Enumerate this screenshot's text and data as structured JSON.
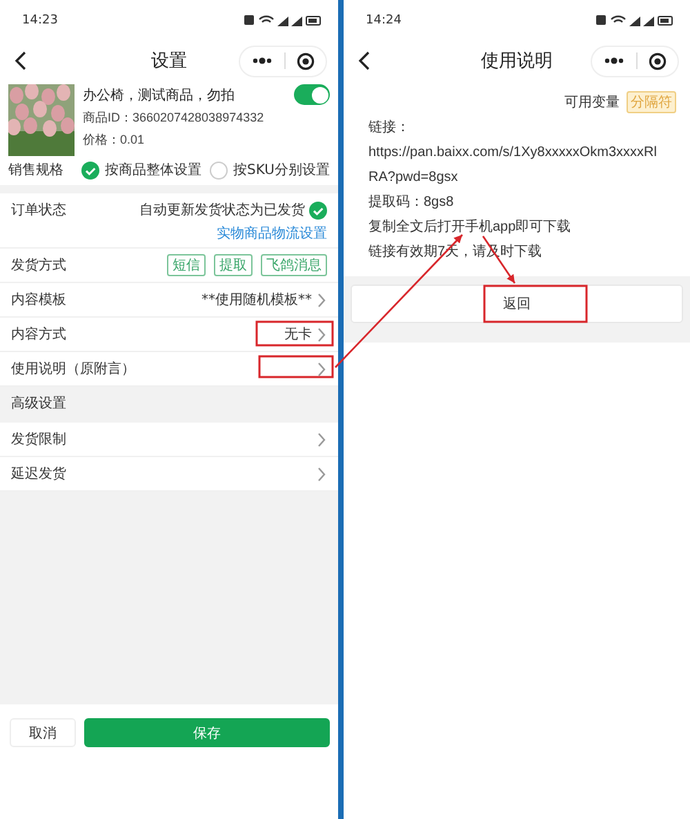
{
  "left_screen": {
    "status_bar": {
      "time": "14:23"
    },
    "title": "设置",
    "product": {
      "name": "办公椅，测试商品，勿拍",
      "enabled": true,
      "id": "商品ID：3660207428038974332",
      "price": "价格：0.01"
    },
    "sales_spec": {
      "label": "销售规格",
      "options": [
        {
          "label": "按商品整体设置",
          "selected": true
        },
        {
          "label": "按SKU分别设置",
          "selected": false
        }
      ]
    },
    "order_status": {
      "label": "订单状态",
      "value": "自动更新发货状态为已发货",
      "checked": true,
      "link": "实物商品物流设置"
    },
    "delivery_method": {
      "label": "发货方式",
      "tags": [
        "短信",
        "提取",
        "飞鸽消息"
      ]
    },
    "rows": [
      {
        "label": "内容模板",
        "value": "**使用随机模板**"
      },
      {
        "label": "内容方式",
        "value": "无卡"
      },
      {
        "label": "使用说明（原附言）"
      }
    ],
    "advanced": {
      "title": "高级设置",
      "rows": [
        {
          "label": "发货限制"
        },
        {
          "label": "延迟发货"
        }
      ]
    },
    "buttons": {
      "cancel": "取消",
      "save": "保存"
    }
  },
  "right_screen": {
    "status_bar": {
      "time": "14:24"
    },
    "title": "使用说明",
    "variables": {
      "label": "可用变量",
      "tag": "分隔符"
    },
    "lines": [
      "链接：",
      "https://pan.baixx.com/s/1Xy8xxxxxOkm3xxxxRl",
      "RA?pwd=8gsx",
      "提取码：8gs8",
      "复制全文后打开手机app即可下载",
      "链接有效期7天，请及时下载"
    ],
    "back_button": "返回"
  }
}
